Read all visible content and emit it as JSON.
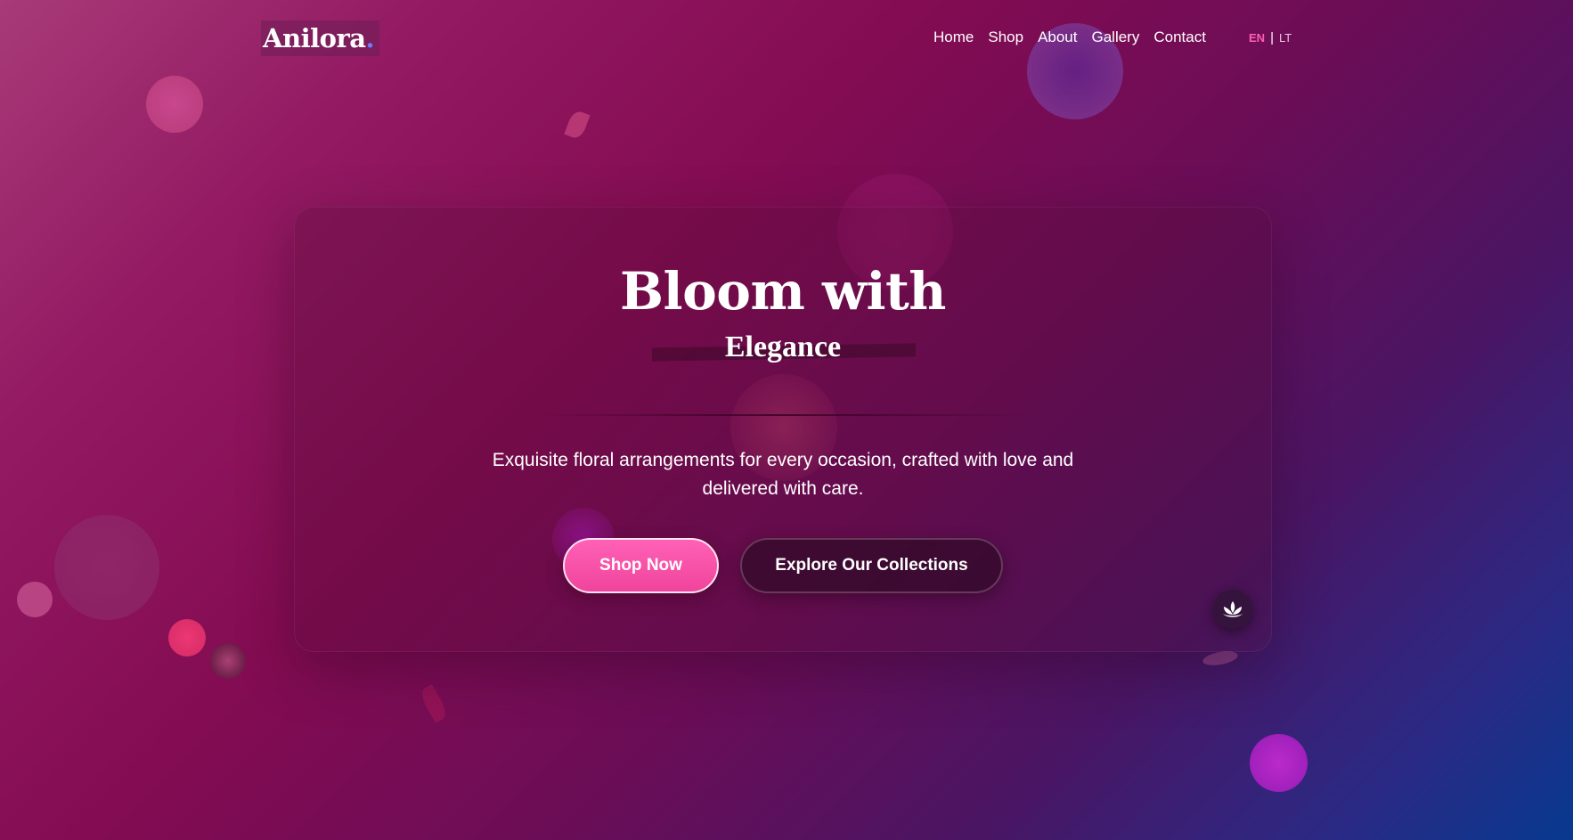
{
  "header": {
    "logo": {
      "text": "Anilora",
      "dot": "."
    },
    "nav": [
      {
        "label": "Home"
      },
      {
        "label": "Shop"
      },
      {
        "label": "About"
      },
      {
        "label": "Gallery"
      },
      {
        "label": "Contact"
      }
    ],
    "language": {
      "active": "EN",
      "separator": "|",
      "other": "LT"
    }
  },
  "hero": {
    "title": "Bloom with",
    "subtitle": "Elegance",
    "description": "Exquisite floral arrangements for every occasion, crafted with love and delivered with care.",
    "primary_button": "Shop Now",
    "secondary_button": "Explore Our Collections",
    "floating_button_icon": "lotus-icon"
  },
  "colors": {
    "accent_pink": "#ff5fb3",
    "logo_dot": "#6d7bff",
    "background_start": "#a83a78",
    "background_end": "#07398f"
  }
}
